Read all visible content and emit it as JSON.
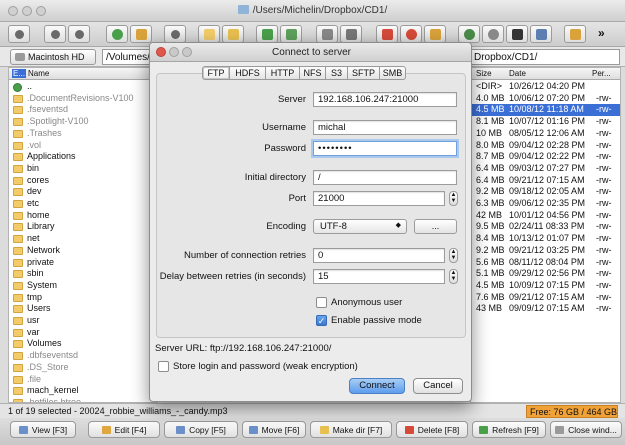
{
  "window": {
    "title": "/Users/Michelin/Dropbox/CD1/"
  },
  "pathbar": {
    "drive_label": "Macintosh HD",
    "left_path": "/Volumes/",
    "right_path": "Dropbox/CD1/"
  },
  "left_panel": {
    "headers": {
      "ext": "E...",
      "name": "Name"
    },
    "rows": [
      {
        "name": "..",
        "dim": false,
        "up": true
      },
      {
        "name": ".DocumentRevisions-V100",
        "dim": true
      },
      {
        "name": ".fseventsd",
        "dim": true
      },
      {
        "name": ".Spotlight-V100",
        "dim": true
      },
      {
        "name": ".Trashes",
        "dim": true
      },
      {
        "name": ".vol",
        "dim": true
      },
      {
        "name": "Applications",
        "dim": false
      },
      {
        "name": "bin",
        "dim": false
      },
      {
        "name": "cores",
        "dim": false
      },
      {
        "name": "dev",
        "dim": false
      },
      {
        "name": "etc",
        "dim": false
      },
      {
        "name": "home",
        "dim": false
      },
      {
        "name": "Library",
        "dim": false
      },
      {
        "name": "net",
        "dim": false
      },
      {
        "name": "Network",
        "dim": false
      },
      {
        "name": "private",
        "dim": false
      },
      {
        "name": "sbin",
        "dim": false
      },
      {
        "name": "System",
        "dim": false
      },
      {
        "name": "tmp",
        "dim": false
      },
      {
        "name": "Users",
        "dim": false
      },
      {
        "name": "usr",
        "dim": false
      },
      {
        "name": "var",
        "dim": false
      },
      {
        "name": "Volumes",
        "dim": false
      },
      {
        "name": ".dbfseventsd",
        "dim": true
      },
      {
        "name": ".DS_Store",
        "dim": true
      },
      {
        "name": ".file",
        "dim": true
      },
      {
        "name": "mach_kernel",
        "dim": false
      },
      {
        "name": ".hotfiles.btree",
        "dim": true
      }
    ]
  },
  "right_panel": {
    "headers": {
      "size": "Size",
      "date": "Date",
      "perm": "Per..."
    },
    "rows": [
      {
        "size": "<DIR>",
        "date": "10/26/12 04:20 PM",
        "perm": "",
        "selected": false
      },
      {
        "size": "4.0 MB",
        "date": "10/06/12 07:20 PM",
        "perm": "-rw-",
        "selected": false
      },
      {
        "size": "4.5 MB",
        "date": "10/08/12 11:18 AM",
        "perm": "-rw-",
        "selected": true
      },
      {
        "size": "8.1 MB",
        "date": "10/07/12 01:16 PM",
        "perm": "-rw-",
        "selected": false
      },
      {
        "size": "10 MB",
        "date": "08/05/12 12:06 AM",
        "perm": "-rw-",
        "selected": false
      },
      {
        "size": "8.0 MB",
        "date": "09/04/12 02:28 PM",
        "perm": "-rw-",
        "selected": false
      },
      {
        "size": "8.7 MB",
        "date": "09/04/12 02:22 PM",
        "perm": "-rw-",
        "selected": false
      },
      {
        "size": "6.4 MB",
        "date": "09/03/12 07:27 PM",
        "perm": "-rw-",
        "selected": false
      },
      {
        "size": "6.4 MB",
        "date": "09/21/12 07:15 AM",
        "perm": "-rw-",
        "selected": false
      },
      {
        "size": "9.2 MB",
        "date": "09/18/12 02:05 AM",
        "perm": "-rw-",
        "selected": false
      },
      {
        "size": "6.3 MB",
        "date": "09/06/12 02:35 PM",
        "perm": "-rw-",
        "selected": false
      },
      {
        "size": "42 MB",
        "date": "10/01/12 04:56 PM",
        "perm": "-rw-",
        "selected": false
      },
      {
        "size": "9.5 MB",
        "date": "02/24/11 08:33 PM",
        "perm": "-rw-",
        "selected": false
      },
      {
        "size": "8.4 MB",
        "date": "10/13/12 01:07 PM",
        "perm": "-rw-",
        "selected": false
      },
      {
        "size": "9.2 MB",
        "date": "09/21/12 03:25 PM",
        "perm": "-rw-",
        "selected": false
      },
      {
        "size": "5.6 MB",
        "date": "08/11/12 08:04 PM",
        "perm": "-rw-",
        "selected": false
      },
      {
        "size": "5.1 MB",
        "date": "09/29/12 02:56 PM",
        "perm": "-rw-",
        "selected": false
      },
      {
        "size": "4.5 MB",
        "date": "10/09/12 07:15 PM",
        "perm": "-rw-",
        "selected": false
      },
      {
        "size": "7.6 MB",
        "date": "09/21/12 07:15 AM",
        "perm": "-rw-",
        "selected": false
      },
      {
        "size": "43 MB",
        "date": "09/09/12 07:15 AM",
        "perm": "-rw-",
        "selected": false
      }
    ]
  },
  "status": {
    "selection": "1 of 19 selected - 20024_robbie_williams_-_candy.mp3",
    "free": "Free: 76 GB / 464 GB"
  },
  "function_keys": [
    {
      "label": "View [F3]",
      "color": "#6b8fc8"
    },
    {
      "label": "Edit [F4]",
      "color": "#e0a640"
    },
    {
      "label": "Copy [F5]",
      "color": "#6b8fc8"
    },
    {
      "label": "Move [F6]",
      "color": "#6b8fc8"
    },
    {
      "label": "Make dir [F7]",
      "color": "#e8c050"
    },
    {
      "label": "Delete [F8]",
      "color": "#d64a3a"
    },
    {
      "label": "Refresh [F9]",
      "color": "#4aa04a"
    },
    {
      "label": "Close wind...",
      "color": "#9a9a9a"
    }
  ],
  "dialog": {
    "title": "Connect to server",
    "tabs": [
      "FTP",
      "HDFS",
      "HTTP",
      "NFS",
      "S3",
      "SFTP",
      "SMB"
    ],
    "active_tab": "FTP",
    "server_label": "Server",
    "server_value": "192.168.106.247:21000",
    "username_label": "Username",
    "username_value": "michal",
    "password_label": "Password",
    "password_value": "••••••••",
    "initial_dir_label": "Initial directory",
    "initial_dir_value": "/",
    "port_label": "Port",
    "port_value": "21000",
    "encoding_label": "Encoding",
    "encoding_value": "UTF-8",
    "encoding_more_label": "...",
    "retries_label": "Number of connection retries",
    "retries_value": "0",
    "delay_label": "Delay between retries (in seconds)",
    "delay_value": "15",
    "anonymous_label": "Anonymous user",
    "anonymous_checked": false,
    "passive_label": "Enable passive mode",
    "passive_checked": true,
    "server_url": "Server URL: ftp://192.168.106.247:21000/",
    "store_label": "Store login and password (weak encryption)",
    "store_checked": false,
    "connect_label": "Connect",
    "cancel_label": "Cancel"
  },
  "colors": {
    "selection": "#3b6fd6",
    "folder": "#f2cc6a",
    "free_badge": "#f0a238",
    "primary_button": "#5d9ded"
  }
}
